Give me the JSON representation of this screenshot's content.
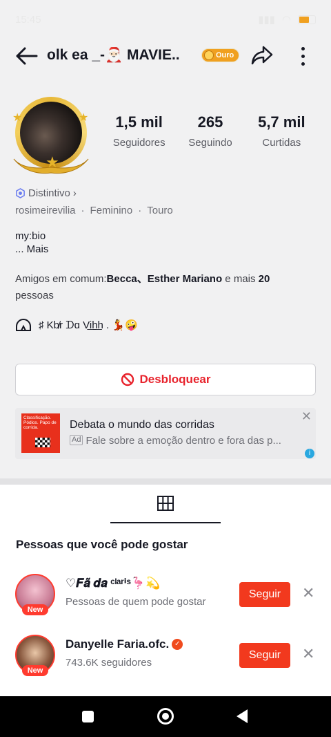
{
  "status_bar": {
    "time": "15:45",
    "battery": "67"
  },
  "header": {
    "title": "olk ea _-🎅🏻 MAVIE..",
    "tier_badge": "Ouro"
  },
  "stats": [
    {
      "value": "1,5 mil",
      "label": "Seguidores"
    },
    {
      "value": "265",
      "label": "Seguindo"
    },
    {
      "value": "5,7 mil",
      "label": "Curtidas"
    }
  ],
  "profile": {
    "badge_label": "Distintivo",
    "username": "rosimeirevilia",
    "gender": "Feminino",
    "sign": "Touro",
    "bio_line1": "my:bio",
    "bio_more": "...  Mais",
    "friends_prefix": "Amigos em comum:",
    "friend1": "Becca",
    "friend_sep": "、",
    "friend2": "Esther Mariano",
    "friends_mid": " e mais ",
    "friends_count": "20",
    "friends_suffix": " pessoas",
    "link_text": "♯ Kb̸r ᗪɑ Vi͟h͟h . 💃🤪"
  },
  "unblock_button": "Desbloquear",
  "ad": {
    "image_text": "Classificação. Pódios. Papo de corrida.",
    "title": "Debata o mundo das corridas",
    "tag": "Ad",
    "description": "Fale sobre a emoção dentro e fora das p..."
  },
  "suggestions": {
    "title": "Pessoas que você pode gostar",
    "follow_label": "Seguir",
    "new_label": "New",
    "people": [
      {
        "name": "♡𝑭𝒂̃ 𝒅𝒂 ᶜˡᵃʳⁱˢ🦩💫",
        "sub": "Pessoas de quem pode gostar"
      },
      {
        "name": "Danyelle Faria.ofc.",
        "sub": "743.6K seguidores"
      }
    ]
  }
}
